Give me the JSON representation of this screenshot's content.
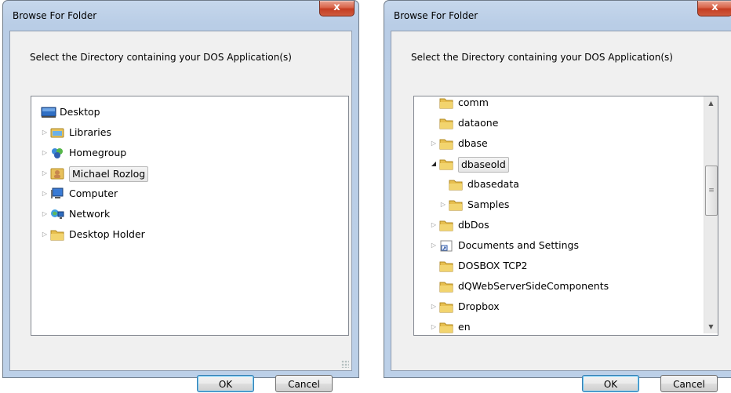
{
  "dialogs": [
    {
      "title": "Browse For Folder",
      "close_label": "x",
      "instruction": "Select the Directory containing your DOS Application(s)",
      "tree": [
        {
          "label": "Desktop",
          "icon": "desktop-icon",
          "expander": ""
        },
        {
          "label": "Libraries",
          "icon": "libraries-icon",
          "expander": "▷"
        },
        {
          "label": "Homegroup",
          "icon": "homegroup-icon",
          "expander": "▷"
        },
        {
          "label": "Michael Rozlog",
          "icon": "user-folder-icon",
          "expander": "▷",
          "selected": true
        },
        {
          "label": "Computer",
          "icon": "computer-icon",
          "expander": "▷"
        },
        {
          "label": "Network",
          "icon": "network-icon",
          "expander": "▷"
        },
        {
          "label": "Desktop Holder",
          "icon": "folder-icon",
          "expander": "▷"
        }
      ],
      "ok_label": "OK",
      "cancel_label": "Cancel"
    },
    {
      "title": "Browse For Folder",
      "close_label": "x",
      "instruction": "Select the Directory containing your DOS Application(s)",
      "tree": [
        {
          "label": "comm",
          "icon": "folder-icon",
          "expander": ""
        },
        {
          "label": "dataone",
          "icon": "folder-icon",
          "expander": ""
        },
        {
          "label": "dbase",
          "icon": "folder-icon",
          "expander": "▷"
        },
        {
          "label": "dbaseold",
          "icon": "folder-icon",
          "expander": "◢",
          "selected": true
        },
        {
          "label": "dbasedata",
          "icon": "folder-icon",
          "expander": ""
        },
        {
          "label": "Samples",
          "icon": "folder-icon",
          "expander": "▷"
        },
        {
          "label": "dbDos",
          "icon": "folder-icon",
          "expander": "▷"
        },
        {
          "label": "Documents and Settings",
          "icon": "shortcut-folder-icon",
          "expander": "▷"
        },
        {
          "label": "DOSBOX TCP2",
          "icon": "folder-icon",
          "expander": ""
        },
        {
          "label": "dQWebServerSideComponents",
          "icon": "folder-icon",
          "expander": ""
        },
        {
          "label": "Dropbox",
          "icon": "folder-icon",
          "expander": "▷"
        },
        {
          "label": "en",
          "icon": "folder-icon",
          "expander": "▷"
        }
      ],
      "ok_label": "OK",
      "cancel_label": "Cancel"
    }
  ],
  "colors": {
    "title_gradient_top": "#c6d7ec",
    "close_red": "#c43d22",
    "selection_border": "#b8b8b8",
    "default_button_glow": "#5ec7f8"
  }
}
